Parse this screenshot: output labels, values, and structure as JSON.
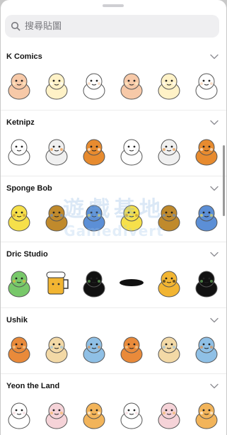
{
  "search": {
    "placeholder": "搜尋貼圖"
  },
  "sections": [
    {
      "title": "K Comics",
      "stickers": [
        "bunny-sticker",
        "bunny-sticker",
        "cat-sticker",
        "cat-sticker",
        "cat-sticker",
        "cat-sticker"
      ]
    },
    {
      "title": "Ketnipz",
      "stickers": [
        "bean-sticker",
        "bean-sticker",
        "bean-sticker",
        "cat-sticker",
        "bean-sticker",
        "bean-sticker"
      ]
    },
    {
      "title": "Sponge Bob",
      "stickers": [
        "spongebob-sticker",
        "spongebob-sticker",
        "spongebob-sticker",
        "spongebob-sticker",
        "spongebob-sticker",
        "spongebob-sticker"
      ]
    },
    {
      "title": "Dric Studio",
      "stickers": [
        "frog-sticker",
        "beer-sticker",
        "frog-sticker",
        "frog-sticker",
        "frog-sticker",
        "frog-sticker"
      ]
    },
    {
      "title": "Ushik",
      "stickers": [
        "monkey-sticker",
        "monkey-sticker",
        "monkey-sticker",
        "monkey-sticker",
        "monkey-sticker",
        "monkey-sticker"
      ]
    },
    {
      "title": "Yeon the Land",
      "stickers": [
        "cat-sticker",
        "cat-sticker",
        "cat-sticker",
        "cat-sticker",
        "cat-sticker",
        "cat-sticker"
      ]
    }
  ],
  "watermark": {
    "line1": "遊戲基地",
    "line2": "Gamedivert"
  },
  "colors": {
    "sheet_bg": "#ffffff",
    "search_bg": "#efeff1",
    "chevron": "#8e8e93",
    "backdrop": "#c9c9c9"
  }
}
